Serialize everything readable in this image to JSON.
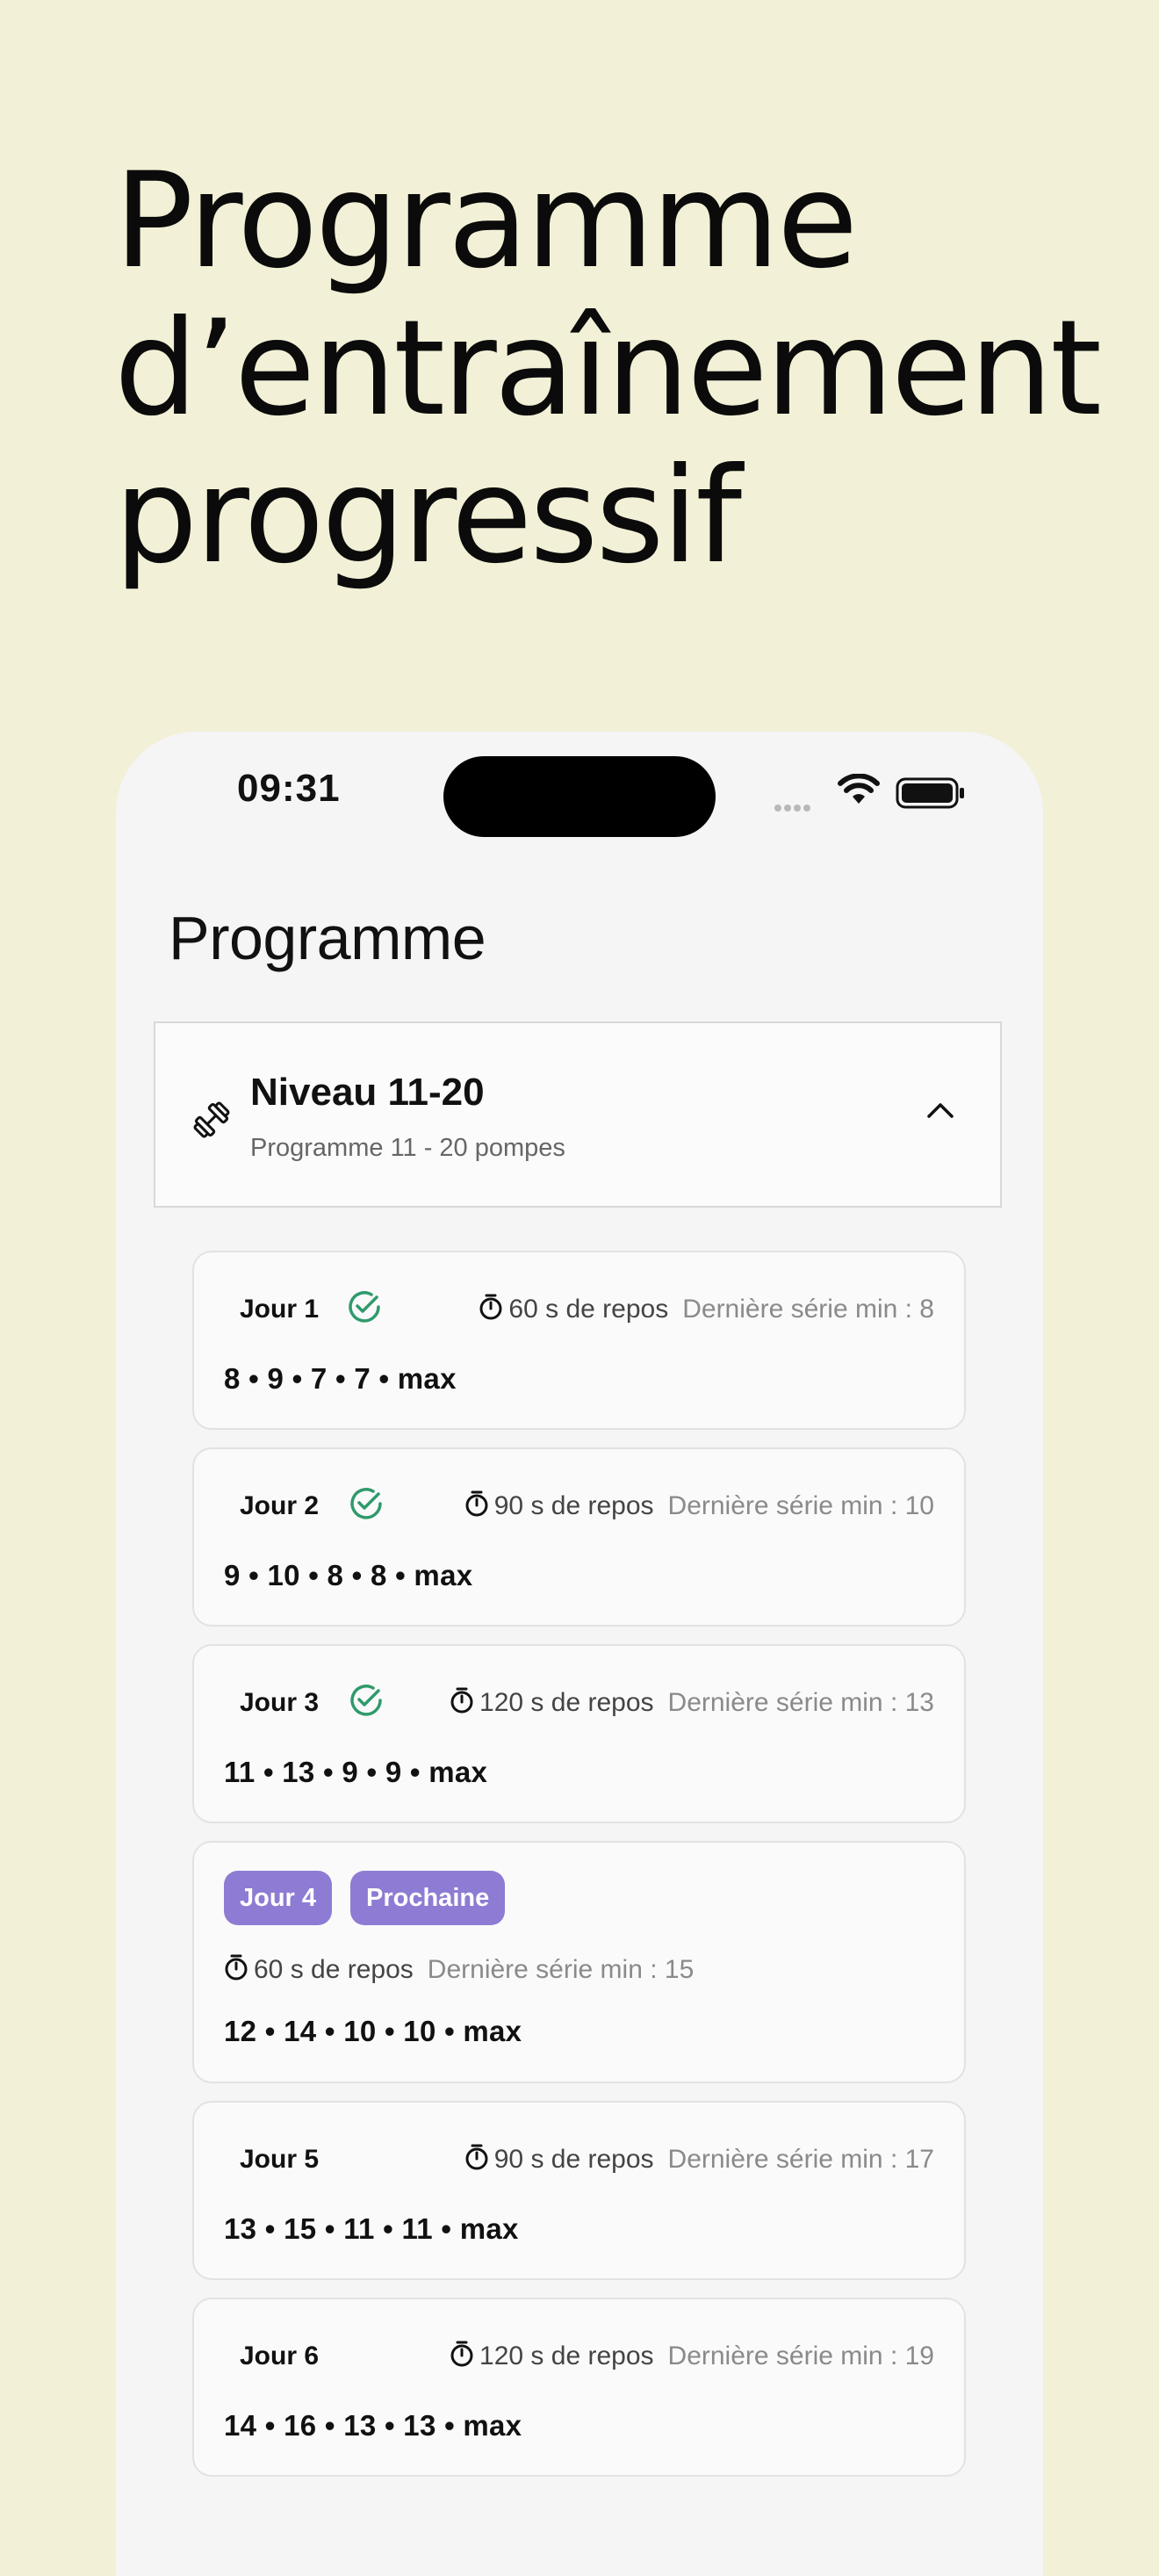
{
  "headline": [
    "Programme",
    "d’entraînement",
    "progressif"
  ],
  "status_bar": {
    "time": "09:31"
  },
  "screen": {
    "title": "Programme"
  },
  "level": {
    "name": "Niveau 11-20",
    "subtitle": "Programme 11 - 20 pompes",
    "icon": "dumbbell-icon",
    "expand_icon": "chevron-up-icon"
  },
  "colors": {
    "background": "#f2f0d6",
    "accent": "#8e7bd3",
    "done": "#2f9a6c"
  },
  "days": [
    {
      "label": "Jour 1",
      "done": true,
      "rest": "60 s de repos",
      "last": "Dernière série min : 8",
      "sets": "8 • 9 • 7 • 7 • max"
    },
    {
      "label": "Jour 2",
      "done": true,
      "rest": "90 s de repos",
      "last": "Dernière série min : 10",
      "sets": "9 • 10 • 8 • 8 • max"
    },
    {
      "label": "Jour 3",
      "done": true,
      "rest": "120 s de repos",
      "last": "Dernière série min : 13",
      "sets": "11 • 13 • 9 • 9 • max"
    },
    {
      "label": "Jour 4",
      "badge": "Prochaine",
      "rest": "60 s de repos",
      "last": "Dernière série min : 15",
      "sets": "12 • 14 • 10 • 10 • max"
    },
    {
      "label": "Jour 5",
      "done": false,
      "rest": "90 s de repos",
      "last": "Dernière série min : 17",
      "sets": "13 • 15 • 11 • 11 • max"
    },
    {
      "label": "Jour 6",
      "done": false,
      "rest": "120 s de repos",
      "last": "Dernière série min : 19",
      "sets": "14 • 16 • 13 • 13 • max"
    }
  ]
}
